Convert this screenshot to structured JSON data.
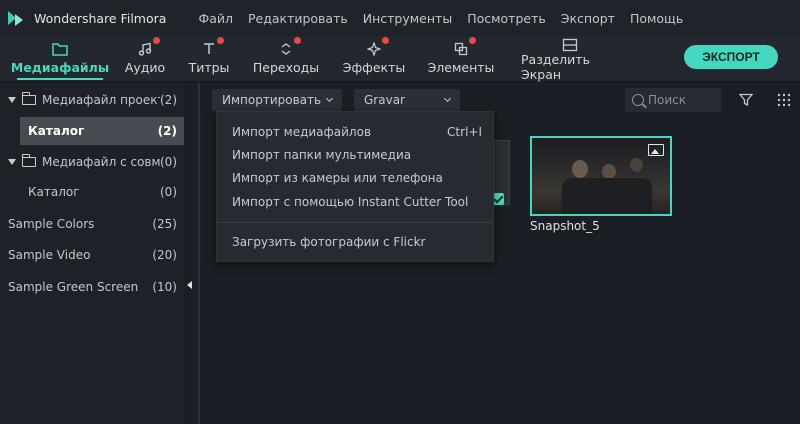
{
  "app": {
    "name": "Wondershare Filmora"
  },
  "menu": [
    "Файл",
    "Редактировать",
    "Инструменты",
    "Посмотреть",
    "Экспорт",
    "Помощь"
  ],
  "toolbar": {
    "tabs": [
      {
        "label": "Медиафайлы",
        "icon": "folder-icon",
        "active": true,
        "badge": false
      },
      {
        "label": "Аудио",
        "icon": "music-note-icon",
        "active": false,
        "badge": true
      },
      {
        "label": "Титры",
        "icon": "text-icon",
        "active": false,
        "badge": true
      },
      {
        "label": "Переходы",
        "icon": "transition-icon",
        "active": false,
        "badge": true
      },
      {
        "label": "Эффекты",
        "icon": "effects-sparkle-icon",
        "active": false,
        "badge": true
      },
      {
        "label": "Элементы",
        "icon": "elements-icon",
        "active": false,
        "badge": true
      },
      {
        "label": "Разделить Экран",
        "icon": "split-screen-icon",
        "active": false,
        "badge": false
      }
    ],
    "export_label": "ЭКСПОРТ"
  },
  "sidebar": {
    "items": [
      {
        "name": "Медиафайл проекта",
        "count": "(2)"
      },
      {
        "name": "Каталог",
        "count": "(2)"
      },
      {
        "name": "Медиафайл с совместим",
        "count": "(0)"
      },
      {
        "name": "Каталог",
        "count": "(0)"
      },
      {
        "name": "Sample Colors",
        "count": "(25)"
      },
      {
        "name": "Sample Video",
        "count": "(20)"
      },
      {
        "name": "Sample Green Screen",
        "count": "(10)"
      }
    ]
  },
  "main": {
    "import_label": "Импортировать",
    "record_label": "Gravar",
    "search_placeholder": "Поиск",
    "thumbnail_label": "Snapshot_5"
  },
  "import_menu": {
    "items": [
      {
        "label": "Импорт медиафайлов",
        "shortcut": "Ctrl+I"
      },
      {
        "label": "Импорт папки мультимедиа",
        "shortcut": ""
      },
      {
        "label": "Импорт из камеры или телефона",
        "shortcut": ""
      },
      {
        "label": "Импорт с помощью Instant Cutter Tool",
        "shortcut": ""
      },
      {
        "label": "Загрузить фотографии с Flickr",
        "shortcut": ""
      }
    ]
  },
  "colors": {
    "accent": "#45d8c0",
    "badge": "#ee4747",
    "background": "#1b1f25"
  }
}
